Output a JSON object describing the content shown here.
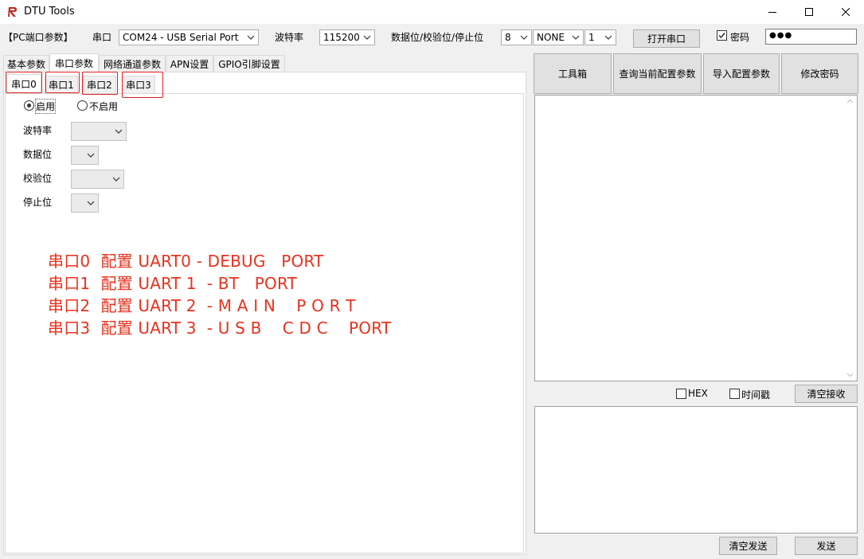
{
  "window": {
    "title": "DTU Tools"
  },
  "toolbar": {
    "pc_params_label": "【PC端口参数】",
    "port_label": "串口",
    "port_value": "COM24 - USB Serial Port",
    "baud_label": "波特率",
    "baud_value": "115200",
    "databits_label": "数据位/校验位/停止位",
    "databits_value": "8",
    "parity_value": "NONE",
    "stopbits_value": "1",
    "open_port_button": "打开串口",
    "password_checkbox_label": "密码",
    "password_checked": true,
    "password_value": "●●●"
  },
  "tabs": [
    {
      "label": "基本参数",
      "active": false
    },
    {
      "label": "串口参数",
      "active": true
    },
    {
      "label": "网络通道参数",
      "active": false
    },
    {
      "label": "APN设置",
      "active": false
    },
    {
      "label": "GPIO引脚设置",
      "active": false
    }
  ],
  "subtabs": [
    {
      "label": "串口0",
      "active": true
    },
    {
      "label": "串口1",
      "active": false
    },
    {
      "label": "串口2",
      "active": false
    },
    {
      "label": "串口3",
      "active": false
    }
  ],
  "uart_form": {
    "enable_label": "启用",
    "disable_label": "不启用",
    "enabled": true,
    "baud_label": "波特率",
    "databits_label": "数据位",
    "parity_label": "校验位",
    "stopbits_label": "停止位"
  },
  "notes": [
    "串口0  配置 UART0 - DEBUG   PORT",
    "串口1  配置 UART 1  - BT   PORT",
    "串口2  配置 UART 2  - M A I N    P O R T",
    "串口3  配置 UART 3  - U S B    C D C    PORT"
  ],
  "right_panel": {
    "toolbox_button": "工具箱",
    "query_config_button": "查询当前配置参数",
    "import_config_button": "导入配置参数",
    "change_password_button": "修改密码",
    "hex_label": "HEX",
    "timestamp_label": "时间戳",
    "clear_receive_button": "清空接收",
    "clear_send_button": "清空发送",
    "send_button": "发送"
  },
  "colors": {
    "annotation_red": "#e8321e",
    "window_bg": "#f0f0f0"
  }
}
